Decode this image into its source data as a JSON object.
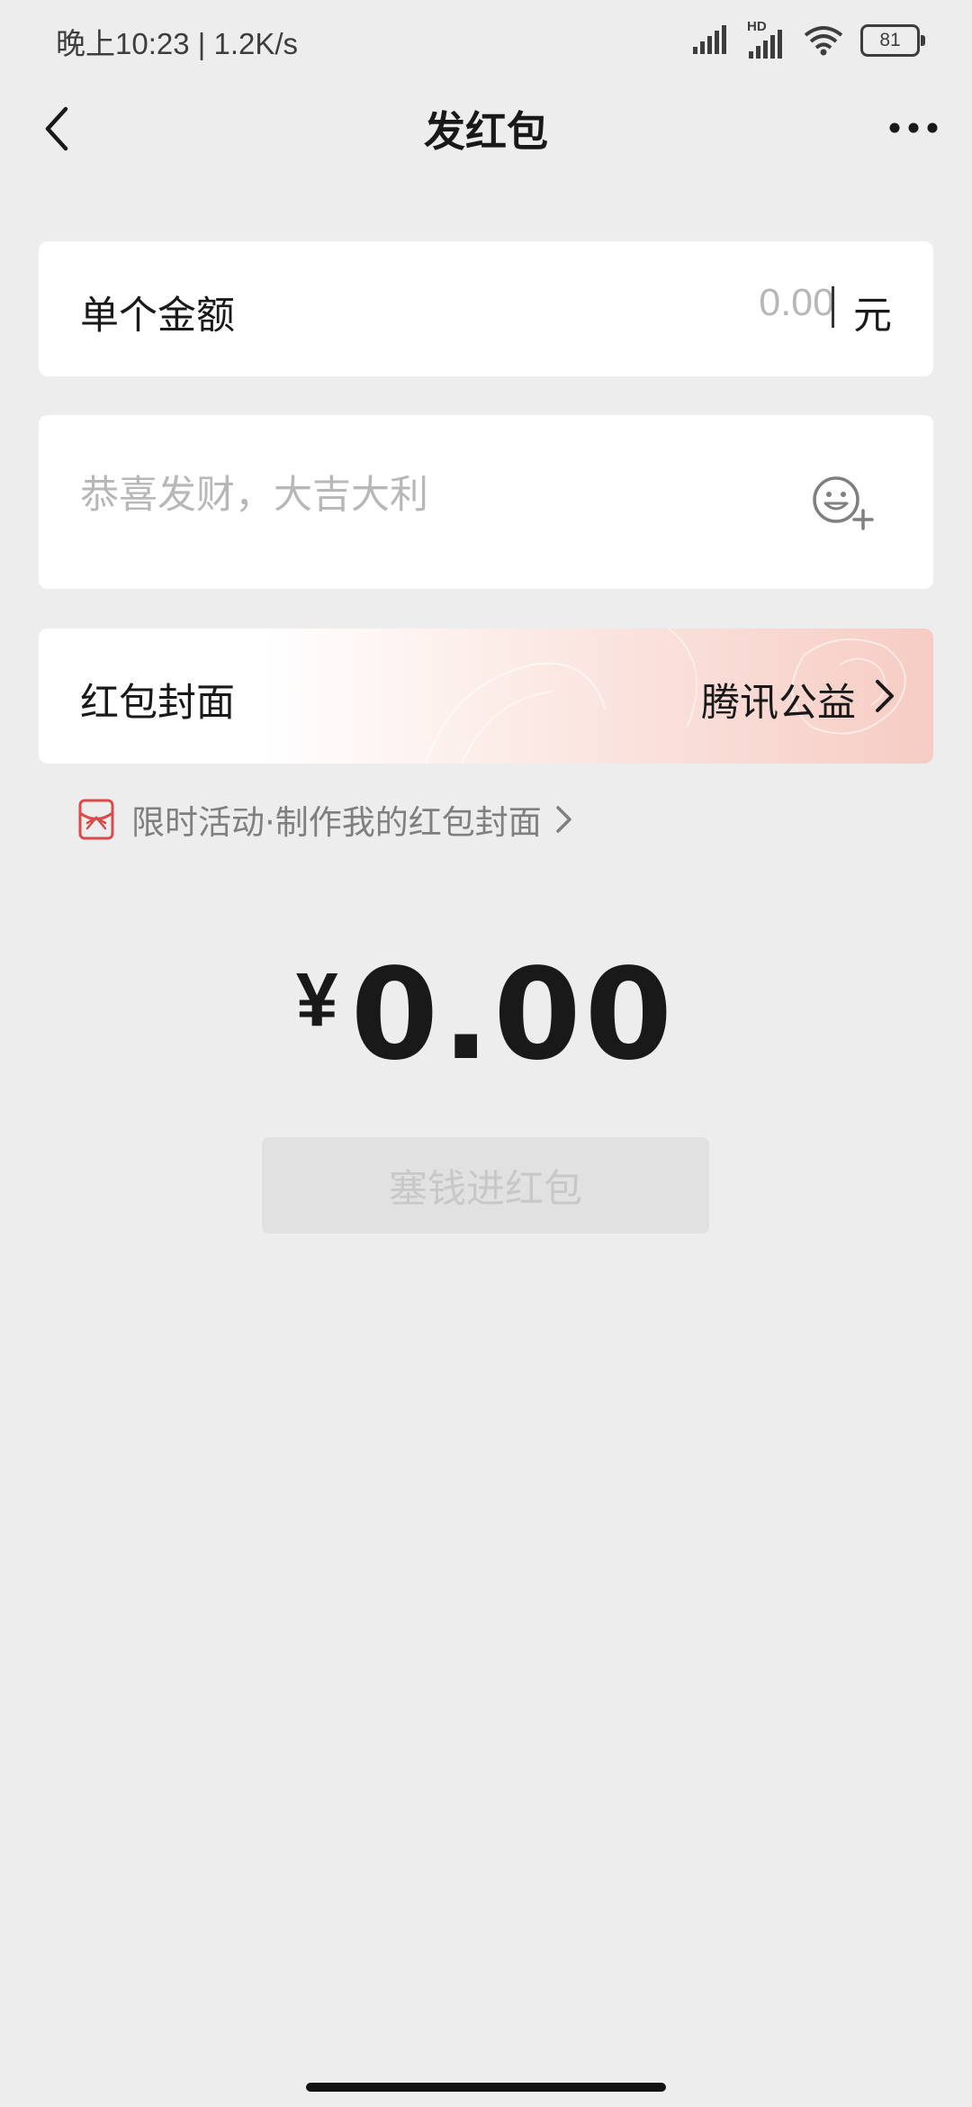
{
  "status_bar": {
    "time_speed": "晚上10:23 | 1.2K/s",
    "network_label": "HD",
    "battery": "81"
  },
  "nav": {
    "title": "发红包"
  },
  "amount": {
    "label": "单个金额",
    "placeholder": "0.00",
    "unit": "元"
  },
  "greeting": {
    "placeholder": "恭喜发财，大吉大利"
  },
  "cover": {
    "label": "红包封面",
    "value": "腾讯公益"
  },
  "promo": {
    "text": "限时活动·制作我的红包封面"
  },
  "total": {
    "currency": "¥",
    "value": "0.00"
  },
  "submit": {
    "label": "塞钱进红包"
  },
  "colors": {
    "background": "#ededed",
    "card": "#ffffff",
    "promo_icon": "#d74b4b",
    "button_disabled": "#e1e1e1"
  }
}
